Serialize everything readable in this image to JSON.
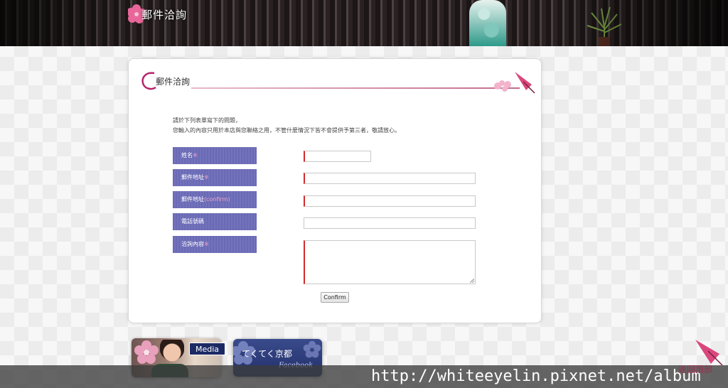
{
  "header": {
    "title": "郵件洽詢"
  },
  "card": {
    "title": "郵件洽詢",
    "intro_line1": "請於下列表單寫下的問題，",
    "intro_line2": "您輸入的內容只用於本店與您聯絡之用，不管什麼情況下皆不會提供予第三者，敬請放心。"
  },
  "form": {
    "required_mark": "※",
    "fields": [
      {
        "label": "姓名",
        "required": true
      },
      {
        "label": "郵件地址",
        "required": true
      },
      {
        "label": "郵件地址",
        "suffix": "(confirm)"
      },
      {
        "label": "電話號碼",
        "required": false
      },
      {
        "label": "洽詢內容",
        "required": true
      }
    ],
    "confirm_label": "Confirm"
  },
  "banners": {
    "media_label": "Media",
    "facebook_title": "てくてく京都",
    "facebook_sub": "Facebook"
  },
  "footer": {
    "back_to_top": "返回頂部",
    "watermark": "http://whiteeyelin.pixnet.net/album"
  },
  "colors": {
    "label_bg": "#6a6ab4",
    "required_mark": "#f3a3c4",
    "field_accent": "#d12b2b",
    "title_line": "#c26b8e"
  }
}
